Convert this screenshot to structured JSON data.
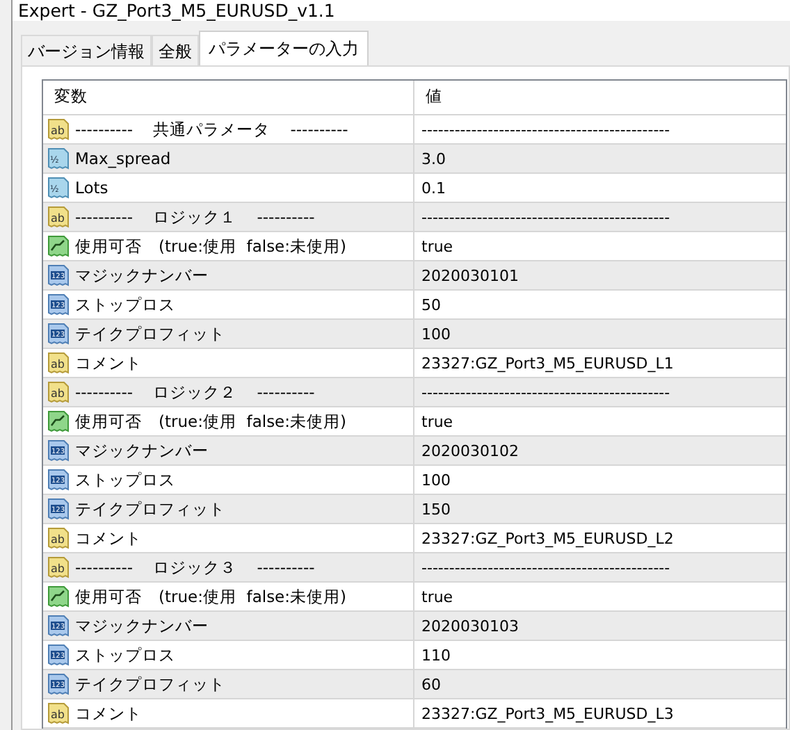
{
  "window": {
    "title": "Expert - GZ_Port3_M5_EURUSD_v1.1"
  },
  "tabs": [
    {
      "label": "バージョン情報",
      "selected": false
    },
    {
      "label": "全般",
      "selected": false
    },
    {
      "label": "パラメーターの入力",
      "selected": true
    }
  ],
  "table": {
    "columns": [
      "変数",
      "値"
    ],
    "rows": [
      {
        "kind": "string",
        "badge": "ab",
        "name": "----------    共通パラメータ    ----------",
        "value": "---------------------------------------------"
      },
      {
        "kind": "double",
        "badge": "½",
        "name": "Max_spread",
        "value": "3.0"
      },
      {
        "kind": "double",
        "badge": "½",
        "name": "Lots",
        "value": "0.1"
      },
      {
        "kind": "string",
        "badge": "ab",
        "name": "----------    ロジック１    ----------",
        "value": "---------------------------------------------"
      },
      {
        "kind": "bool",
        "name": "使用可否　(true:使用  false:未使用)",
        "value": "true"
      },
      {
        "kind": "int",
        "badge": "123",
        "name": "マジックナンバー",
        "value": "2020030101"
      },
      {
        "kind": "int",
        "badge": "123",
        "name": "ストップロス",
        "value": "50"
      },
      {
        "kind": "int",
        "badge": "123",
        "name": "テイクプロフィット",
        "value": "100"
      },
      {
        "kind": "string",
        "badge": "ab",
        "name": "コメント",
        "value": "23327:GZ_Port3_M5_EURUSD_L1"
      },
      {
        "kind": "string",
        "badge": "ab",
        "name": "----------    ロジック２    ----------",
        "value": "---------------------------------------------"
      },
      {
        "kind": "bool",
        "name": "使用可否　(true:使用  false:未使用)",
        "value": "true"
      },
      {
        "kind": "int",
        "badge": "123",
        "name": "マジックナンバー",
        "value": "2020030102"
      },
      {
        "kind": "int",
        "badge": "123",
        "name": "ストップロス",
        "value": "100"
      },
      {
        "kind": "int",
        "badge": "123",
        "name": "テイクプロフィット",
        "value": "150"
      },
      {
        "kind": "string",
        "badge": "ab",
        "name": "コメント",
        "value": "23327:GZ_Port3_M5_EURUSD_L2"
      },
      {
        "kind": "string",
        "badge": "ab",
        "name": "----------    ロジック３    ----------",
        "value": "---------------------------------------------"
      },
      {
        "kind": "bool",
        "name": "使用可否　(true:使用  false:未使用)",
        "value": "true"
      },
      {
        "kind": "int",
        "badge": "123",
        "name": "マジックナンバー",
        "value": "2020030103"
      },
      {
        "kind": "int",
        "badge": "123",
        "name": "ストップロス",
        "value": "110"
      },
      {
        "kind": "int",
        "badge": "123",
        "name": "テイクプロフィット",
        "value": "60"
      },
      {
        "kind": "string",
        "badge": "ab",
        "name": "コメント",
        "value": "23327:GZ_Port3_M5_EURUSD_L3"
      }
    ]
  }
}
